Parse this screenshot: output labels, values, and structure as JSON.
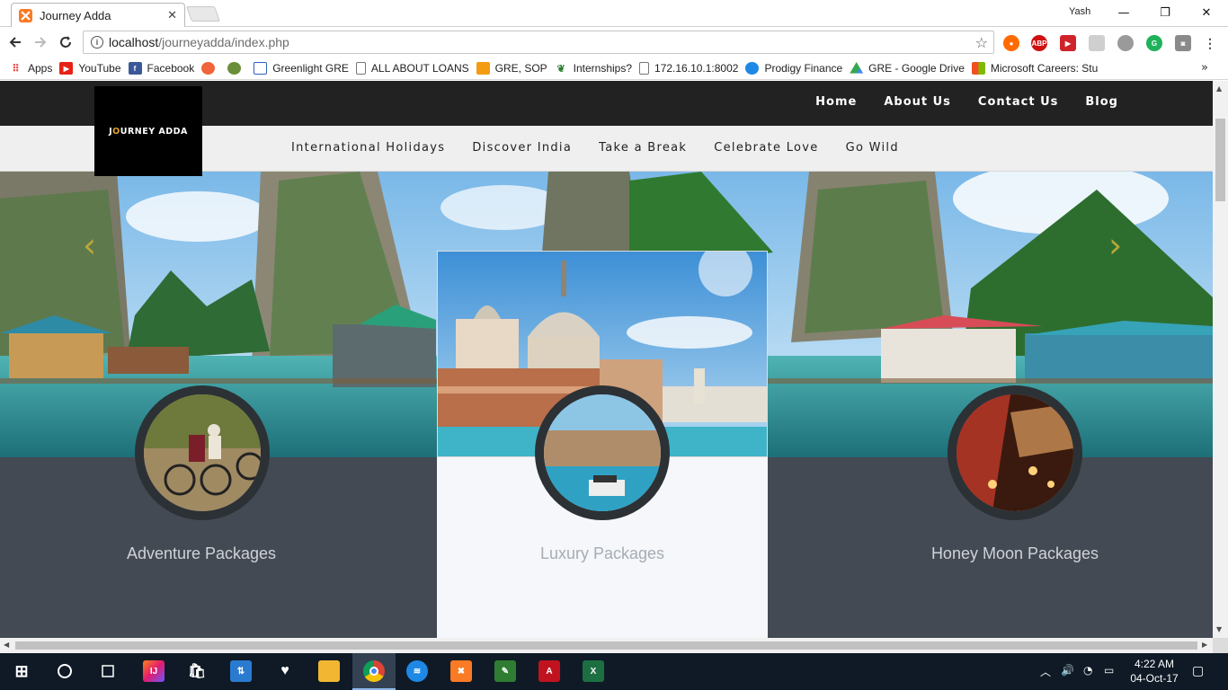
{
  "browser": {
    "tab_title": "Journey Adda",
    "user": "Yash",
    "url_host": "localhost",
    "url_path": "/journeyadda/index.php"
  },
  "bookmarks": [
    {
      "label": "Apps",
      "icon": "apps-grid-icon",
      "color": "#4a86e8"
    },
    {
      "label": "YouTube",
      "icon": "youtube-icon",
      "color": "#e62117"
    },
    {
      "label": "Facebook",
      "icon": "facebook-icon",
      "color": "#3b5998"
    },
    {
      "label": "",
      "icon": "fox-icon",
      "color": "#f0643c"
    },
    {
      "label": "",
      "icon": "owl-icon",
      "color": "#6b8e3a"
    },
    {
      "label": "Greenlight GRE",
      "icon": "page-icon",
      "color": "#3060c0"
    },
    {
      "label": "ALL ABOUT LOANS",
      "icon": "doc-icon",
      "color": "#888888"
    },
    {
      "label": "GRE, SOP",
      "icon": "chart-icon",
      "color": "#f39c12"
    },
    {
      "label": "Internships?",
      "icon": "leaf-icon",
      "color": "#2e7d32"
    },
    {
      "label": "172.16.10.1:8002",
      "icon": "doc-icon",
      "color": "#888888"
    },
    {
      "label": "Prodigy Finance",
      "icon": "bird-icon",
      "color": "#1e88e5"
    },
    {
      "label": "GRE - Google Drive",
      "icon": "drive-icon",
      "color": "#34a853"
    },
    {
      "label": "Microsoft Careers: Stu",
      "icon": "microsoft-icon",
      "color": "#f25022"
    }
  ],
  "site": {
    "logo_pre": "J",
    "logo_o": "O",
    "logo_post": "URNEY ADDA",
    "main_nav": [
      "Home",
      "About Us",
      "Contact Us",
      "Blog"
    ],
    "sub_nav": [
      "International Holidays",
      "Discover India",
      "Take a Break",
      "Celebrate Love",
      "Go Wild"
    ],
    "cards": [
      {
        "title": "Adventure Packages"
      },
      {
        "title": "Luxury Packages"
      },
      {
        "title": "Honey Moon Packages"
      }
    ],
    "colors": {
      "accent_arrow": "#b9a73a",
      "panel_dark": "#444a53",
      "header_dark": "#222222"
    }
  },
  "taskbar": {
    "time": "4:22 AM",
    "date": "04-Oct-17"
  }
}
